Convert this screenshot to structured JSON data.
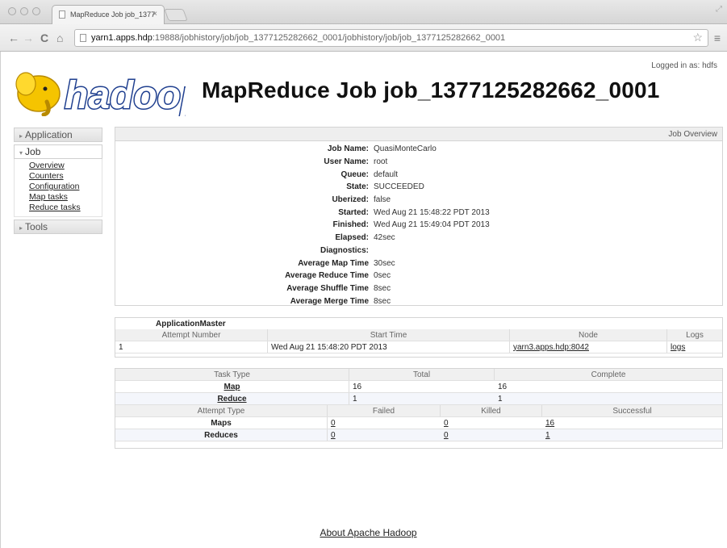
{
  "browser": {
    "tab_title": "MapReduce Job job_1377",
    "tab_close": "×",
    "url_host": "yarn1.apps.hdp",
    "url_rest": ":19888/jobhistory/job/job_1377125282662_0001/jobhistory/job/job_1377125282662_0001",
    "back_glyph": "←",
    "forward_glyph": "→",
    "reload_glyph": "C",
    "home_glyph": "⌂",
    "star_glyph": "☆",
    "menu_glyph": "≡"
  },
  "header": {
    "logo_text": "hadoop",
    "title": "MapReduce Job job_1377125282662_0001",
    "logged_in": "Logged in as: hdfs"
  },
  "sidebar": {
    "application": "Application",
    "job": "Job",
    "job_links": [
      "Overview",
      "Counters",
      "Configuration",
      "Map tasks",
      "Reduce tasks"
    ],
    "tools": "Tools"
  },
  "overview": {
    "heading": "Job Overview",
    "rows": [
      {
        "k": "Job Name:",
        "v": "QuasiMonteCarlo"
      },
      {
        "k": "User Name:",
        "v": "root"
      },
      {
        "k": "Queue:",
        "v": "default"
      },
      {
        "k": "State:",
        "v": "SUCCEEDED"
      },
      {
        "k": "Uberized:",
        "v": "false"
      },
      {
        "k": "Started:",
        "v": "Wed Aug 21 15:48:22 PDT 2013"
      },
      {
        "k": "Finished:",
        "v": "Wed Aug 21 15:49:04 PDT 2013"
      },
      {
        "k": "Elapsed:",
        "v": "42sec"
      },
      {
        "k": "Diagnostics:",
        "v": ""
      },
      {
        "k": "Average Map Time",
        "v": "30sec"
      },
      {
        "k": "Average Reduce Time",
        "v": "0sec"
      },
      {
        "k": "Average Shuffle Time",
        "v": "8sec"
      },
      {
        "k": "Average Merge Time",
        "v": "8sec"
      }
    ]
  },
  "app_master": {
    "title": "ApplicationMaster",
    "headers": [
      "Attempt Number",
      "Start Time",
      "Node",
      "Logs"
    ],
    "row": {
      "attempt": "1",
      "start": "Wed Aug 21 15:48:20 PDT 2013",
      "node": "yarn3.apps.hdp:8042",
      "logs": "logs"
    }
  },
  "tasks": {
    "headers": [
      "Task Type",
      "Total",
      "Complete"
    ],
    "rows": [
      {
        "type": "Map",
        "total": "16",
        "complete": "16"
      },
      {
        "type": "Reduce",
        "total": "1",
        "complete": "1"
      }
    ],
    "attempt_headers": [
      "Attempt Type",
      "Failed",
      "Killed",
      "Successful"
    ],
    "attempt_rows": [
      {
        "type": "Maps",
        "failed": "0",
        "killed": "0",
        "successful": "16"
      },
      {
        "type": "Reduces",
        "failed": "0",
        "killed": "0",
        "successful": "1"
      }
    ]
  },
  "footer": {
    "about": "About Apache Hadoop"
  },
  "colors": {
    "logo_blue": "#1f3f8f",
    "elephant": "#f5c400"
  }
}
